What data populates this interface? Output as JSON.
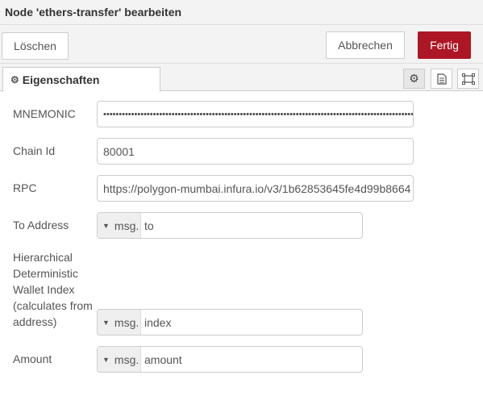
{
  "window": {
    "title": "Node 'ethers-transfer' bearbeiten"
  },
  "buttons": {
    "delete": "Löschen",
    "cancel": "Abbrechen",
    "done": "Fertig"
  },
  "tabs": [
    {
      "label": "Eigenschaften",
      "icon": "gear-icon"
    }
  ],
  "tab_icons": [
    "gear-icon",
    "document-icon",
    "frame-icon"
  ],
  "form": {
    "mnemonic": {
      "label": "MNEMONIC",
      "value": "••••••••••••••••••••••••••••••••••••••••••••••••••••••••••••••••••••••••••••••••••••••••••••••••••••••••"
    },
    "chain_id": {
      "label": "Chain Id",
      "value": "80001"
    },
    "rpc": {
      "label": "RPC",
      "value": "https://polygon-mumbai.infura.io/v3/1b62853645fe4d99b8664"
    },
    "to_address": {
      "label": "To Address",
      "type": "msg.",
      "value": "to"
    },
    "hd_index": {
      "label_lines": [
        "Hierarchical",
        "Deterministic",
        "Wallet Index",
        "(calculates from",
        "address)"
      ],
      "type": "msg.",
      "value": "index"
    },
    "amount": {
      "label": "Amount",
      "type": "msg.",
      "value": "amount"
    }
  },
  "colors": {
    "primary": "#ad1625",
    "header_bg": "#f3f3f3",
    "border": "#cccccc"
  }
}
